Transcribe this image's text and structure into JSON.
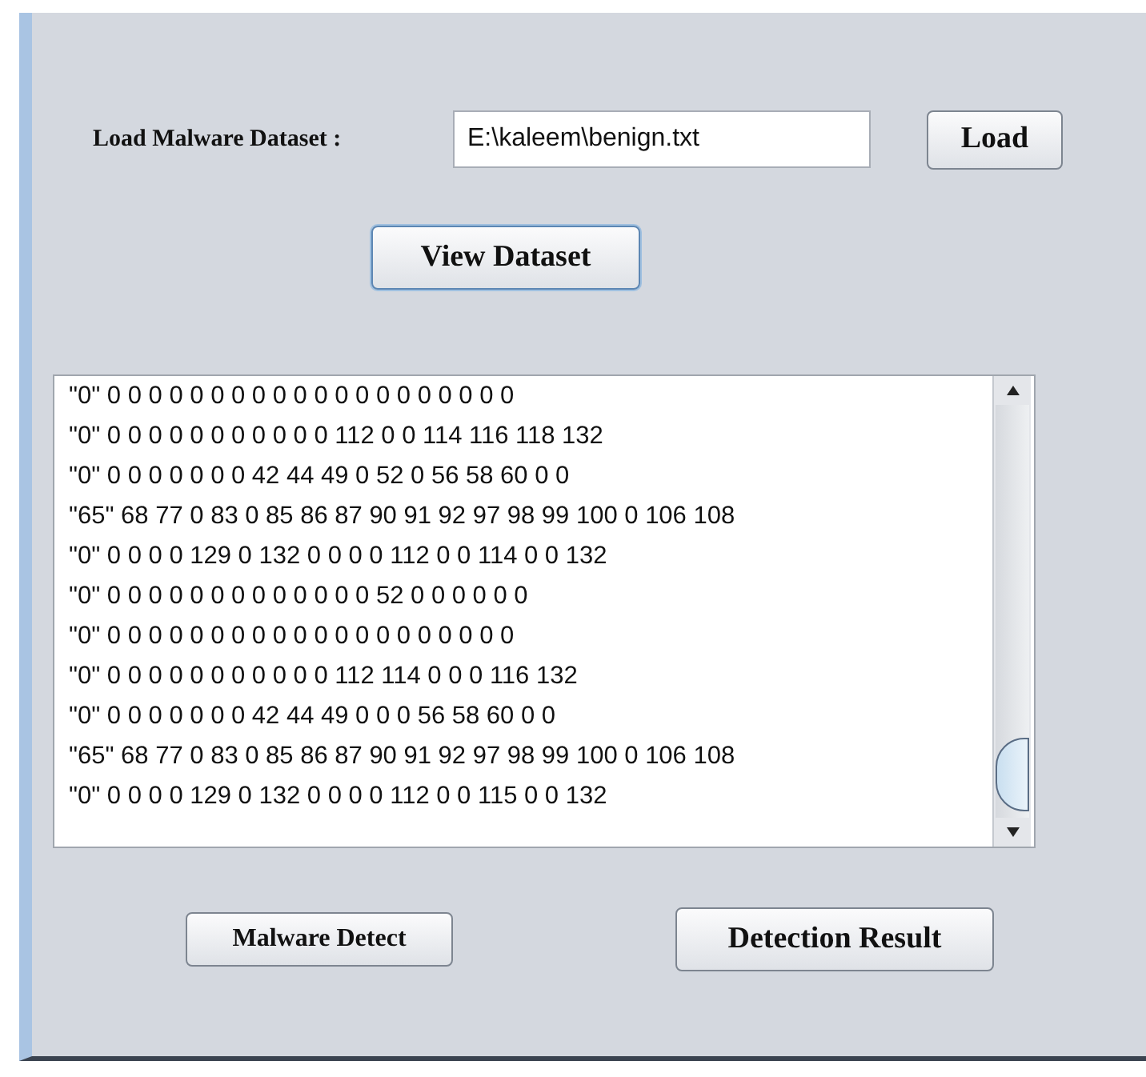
{
  "load_row": {
    "label": "Load Malware Dataset :",
    "path": "E:\\kaleem\\benign.txt",
    "button": "Load"
  },
  "view_button": "View Dataset",
  "dataset_lines": [
    "\"0\" 0 0 0 0 0 0 0 0 0 0 0 0 0 0 0 0 0 0 0 0",
    "\"0\" 0 0 0 0 0 0 0 0 0 0 0 112 0 0 114 116 118 132",
    "\"0\" 0 0 0 0 0 0 0 42 44 49 0 52 0 56 58 60 0 0",
    "\"65\" 68 77 0 83 0 85 86 87 90 91 92 97 98 99 100 0 106 108",
    "\"0\" 0 0 0 0 129 0 132 0 0 0 0 112 0 0 114 0 0 132",
    "\"0\" 0 0 0 0 0 0 0 0 0 0 0 0 0 52 0 0 0 0 0 0",
    "\"0\" 0 0 0 0 0 0 0 0 0 0 0 0 0 0 0 0 0 0 0 0",
    "\"0\" 0 0 0 0 0 0 0 0 0 0 0 112 114 0 0 0 116 132",
    "\"0\" 0 0 0 0 0 0 0 42 44 49 0 0 0 56 58 60 0 0",
    "\"65\" 68 77 0 83 0 85 86 87 90 91 92 97 98 99 100 0 106 108",
    "\"0\" 0 0 0 0 129 0 132 0 0 0 0 112 0 0 115 0 0 132"
  ],
  "bottom_buttons": [
    "Malware Detect",
    "Detection Result"
  ]
}
